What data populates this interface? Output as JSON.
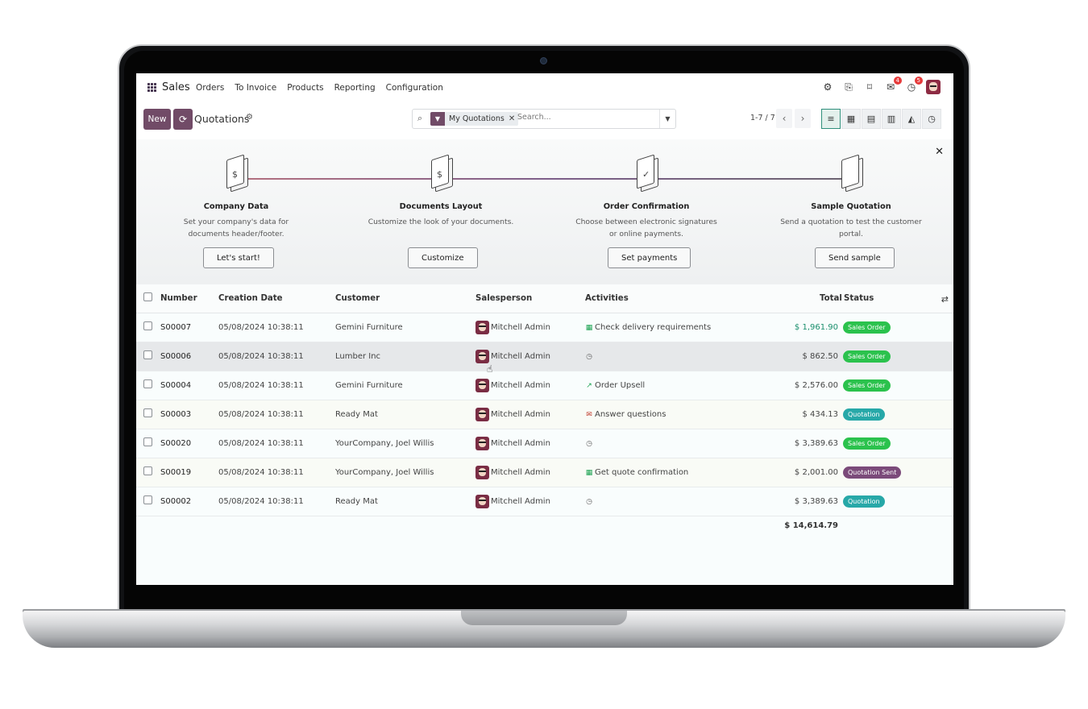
{
  "navbar": {
    "app_name": "Sales",
    "menu": [
      "Orders",
      "To Invoice",
      "Products",
      "Reporting",
      "Configuration"
    ],
    "messages_count": "4",
    "activities_count": "5"
  },
  "control": {
    "new_label": "New",
    "title": "Quotations",
    "facet_label": "My Quotations",
    "search_placeholder": "Search...",
    "pager": "1-7 / 7"
  },
  "onboarding": {
    "steps": [
      {
        "title": "Company Data",
        "desc": "Set your company's data for documents header/footer.",
        "button": "Let's start!"
      },
      {
        "title": "Documents Layout",
        "desc": "Customize the look of your documents.",
        "button": "Customize"
      },
      {
        "title": "Order Confirmation",
        "desc": "Choose between electronic signatures or online payments.",
        "button": "Set payments"
      },
      {
        "title": "Sample Quotation",
        "desc": "Send a quotation to test the customer portal.",
        "button": "Send sample"
      }
    ]
  },
  "table": {
    "headers": {
      "number": "Number",
      "creation_date": "Creation Date",
      "customer": "Customer",
      "salesperson": "Salesperson",
      "activities": "Activities",
      "total": "Total",
      "status": "Status"
    },
    "rows": [
      {
        "number": "S00007",
        "date": "05/08/2024 10:38:11",
        "customer": "Gemini Furniture",
        "salesperson": "Mitchell Admin",
        "activity": "Check delivery requirements",
        "activity_icon": "table-icon",
        "total": "$ 1,961.90",
        "status": "Sales Order"
      },
      {
        "number": "S00006",
        "date": "05/08/2024 10:38:11",
        "customer": "Lumber Inc",
        "salesperson": "Mitchell Admin",
        "activity": "",
        "activity_icon": "clock-icon",
        "total": "$ 862.50",
        "status": "Sales Order"
      },
      {
        "number": "S00004",
        "date": "05/08/2024 10:38:11",
        "customer": "Gemini Furniture",
        "salesperson": "Mitchell Admin",
        "activity": "Order Upsell",
        "activity_icon": "chart-icon",
        "total": "$ 2,576.00",
        "status": "Sales Order"
      },
      {
        "number": "S00003",
        "date": "05/08/2024 10:38:11",
        "customer": "Ready Mat",
        "salesperson": "Mitchell Admin",
        "activity": "Answer questions",
        "activity_icon": "envelope-icon",
        "total": "$ 434.13",
        "status": "Quotation"
      },
      {
        "number": "S00020",
        "date": "05/08/2024 10:38:11",
        "customer": "YourCompany, Joel Willis",
        "salesperson": "Mitchell Admin",
        "activity": "",
        "activity_icon": "clock-icon",
        "total": "$ 3,389.63",
        "status": "Sales Order"
      },
      {
        "number": "S00019",
        "date": "05/08/2024 10:38:11",
        "customer": "YourCompany, Joel Willis",
        "salesperson": "Mitchell Admin",
        "activity": "Get quote confirmation",
        "activity_icon": "table-icon",
        "total": "$ 2,001.00",
        "status": "Quotation Sent"
      },
      {
        "number": "S00002",
        "date": "05/08/2024 10:38:11",
        "customer": "Ready Mat",
        "salesperson": "Mitchell Admin",
        "activity": "",
        "activity_icon": "clock-icon",
        "total": "$ 3,389.63",
        "status": "Quotation"
      }
    ],
    "grand_total": "$ 14,614.79"
  },
  "colors": {
    "brand": "#714b67",
    "sales_order": "#2bc24d",
    "quotation": "#27a8a8",
    "quotation_sent": "#7b4a7a",
    "positive_total": "#1a8f6d"
  }
}
